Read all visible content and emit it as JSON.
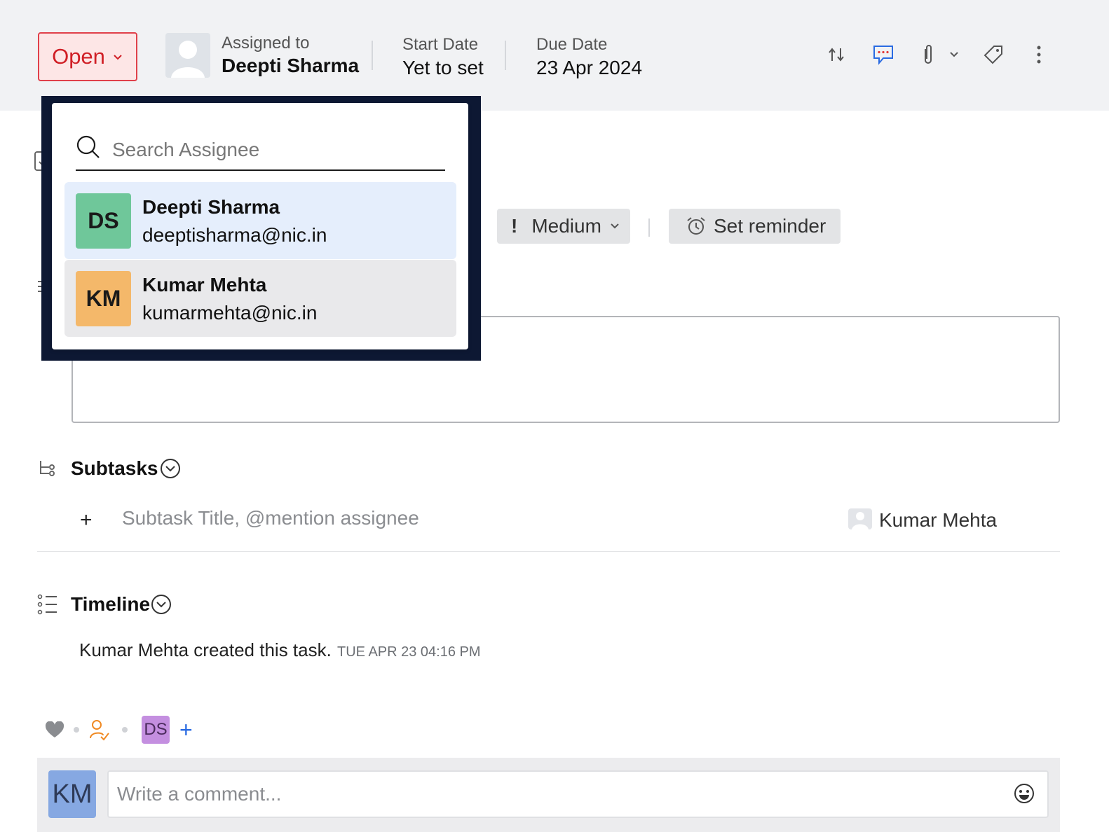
{
  "header": {
    "status": {
      "label": "Open",
      "color": "#d01f26"
    },
    "assigned_to": {
      "label": "Assigned to",
      "name": "Deepti Sharma"
    },
    "start_date": {
      "label": "Start Date",
      "value": "Yet to set"
    },
    "due_date": {
      "label": "Due Date",
      "value": "23 Apr 2024"
    },
    "actions": [
      "swap-icon",
      "comment-dots-icon",
      "attachment-icon",
      "chevron-down-icon",
      "tag-icon",
      "more-vertical-icon"
    ]
  },
  "details": {
    "priority": {
      "label": "Medium",
      "icon": "exclamation-icon"
    },
    "reminder": {
      "label": "Set reminder",
      "icon": "alarm-icon"
    }
  },
  "subtasks": {
    "title": "Subtasks",
    "add_symbol": "+",
    "placeholder": "Subtask Title, @mention assignee",
    "assignee": "Kumar Mehta"
  },
  "timeline": {
    "title": "Timeline",
    "entries": [
      {
        "text": "Kumar Mehta created this task.",
        "time": "TUE APR 23 04:16 PM"
      }
    ]
  },
  "reactions": {
    "followers_initials": "DS",
    "add_symbol": "+"
  },
  "comment": {
    "user_initials": "KM",
    "placeholder": "Write a comment..."
  },
  "assignee_dropdown": {
    "search_placeholder": "Search Assignee",
    "options": [
      {
        "initials": "DS",
        "name": "Deepti Sharma",
        "email": "deeptisharma@nic.in",
        "color": "#6fc79a",
        "selected": true
      },
      {
        "initials": "KM",
        "name": "Kumar Mehta",
        "email": "kumarmehta@nic.in",
        "color": "#f4b86a",
        "selected": false
      }
    ]
  }
}
